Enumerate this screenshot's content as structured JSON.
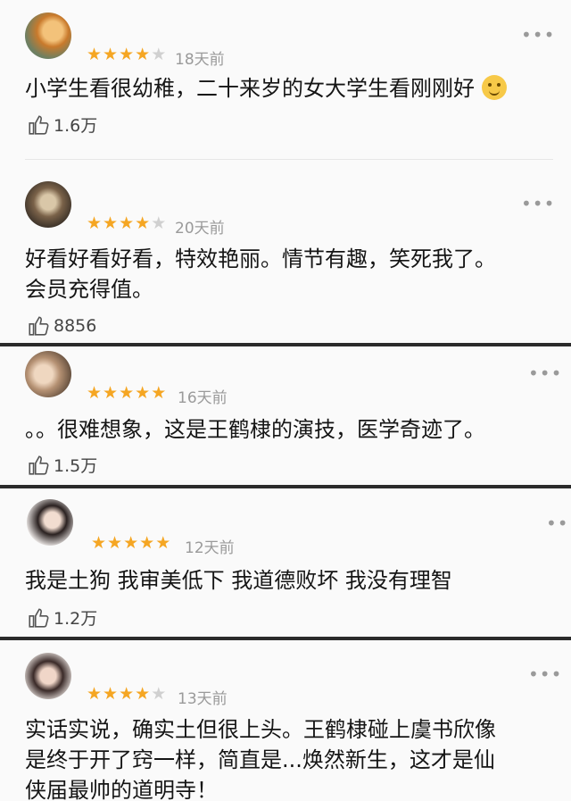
{
  "comments": [
    {
      "stars": 4,
      "time": "18天前",
      "text": "小学生看很幼稚，二十来岁的女大学生看刚刚好",
      "emoji": "hand-over-mouth-emoji",
      "likes": "1.6万"
    },
    {
      "stars": 4,
      "time": "20天前",
      "text_lines": [
        "好看好看好看，特效艳丽。情节有趣，笑死我了。",
        "会员充得值。"
      ],
      "likes": "8856"
    },
    {
      "stars": 5,
      "time": "16天前",
      "text": "。。很难想象，这是王鹤棣的演技，医学奇迹了。",
      "likes": "1.5万"
    },
    {
      "stars": 5,
      "time": "12天前",
      "text": "我是土狗 我审美低下 我道德败坏 我没有理智",
      "likes": "1.2万"
    },
    {
      "stars": 4,
      "time": "13天前",
      "text_lines": [
        "实话实说，确实土但很上头。王鹤棣碰上虞书欣像",
        "是终于开了窍一样，简直是...焕然新生，这才是仙",
        "侠届最帅的道明寺！"
      ]
    }
  ],
  "more_glyph": "•••",
  "colors": {
    "star_on": "#f5a623",
    "star_off": "#d0d0d0"
  },
  "icons": {
    "like": "thumbs-up-icon",
    "more": "more-dots-icon"
  }
}
